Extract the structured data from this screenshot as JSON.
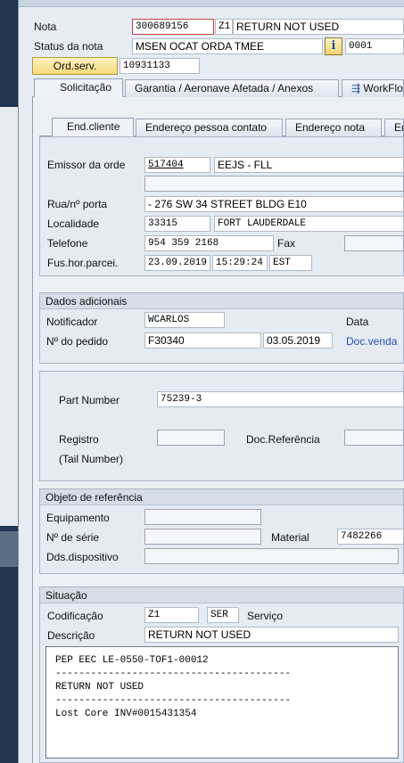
{
  "header": {
    "nota_label": "Nota",
    "nota_number": "300689156",
    "nota_type": "Z1",
    "nota_text": "RETURN NOT USED",
    "status_label": "Status da nota",
    "status_value": "MSEN OCAT ORDA TMEE",
    "status_code": "0001",
    "ordserv_label": "Ord.serv.",
    "ordserv_value": "10931133"
  },
  "main_tabs": {
    "solicitacao": "Solicitação",
    "garantia": "Garantia  / Aeronave Afetada / Anexos",
    "workflow": "WorkFlo"
  },
  "sub_tabs": {
    "end_cliente": "End.cliente",
    "endereco_pessoa": "Endereço pessoa contato",
    "endereco_nota": "Endereço nota",
    "en": "En"
  },
  "cliente": {
    "emissor_label": "Emissor da orde",
    "emissor_code": "517404",
    "emissor_name": "EEJS - FLL",
    "rua_label": "Rua/nº porta",
    "rua_value": "- 276 SW 34 STREET BLDG E10",
    "localidade_label": "Localidade",
    "cep": "33315",
    "cidade": "FORT LAUDERDALE",
    "telefone_label": "Telefone",
    "telefone": "954 359 2168",
    "fax_label": "Fax",
    "fushor_label": "Fus.hor.parcei.",
    "data": "23.09.2019",
    "hora": "15:29:24",
    "fuso": "EST"
  },
  "dados": {
    "title": "Dados adicionais",
    "notificador_label": "Notificador",
    "notificador": "WCARLOS",
    "data_label": "Data",
    "pedido_label": "Nº do pedido",
    "pedido": "F30340",
    "pedido_data": "03.05.2019",
    "docvenda": "Doc.venda"
  },
  "part": {
    "part_label": "Part Number",
    "part_value": "75239-3",
    "registro_label": "Registro",
    "tail_label": "(Tail Number)",
    "docref_label": "Doc.Referência"
  },
  "objeto": {
    "title": "Objeto de referência",
    "equip_label": "Equipamento",
    "serie_label": "Nº de série",
    "material_label": "Material",
    "material": "7482266",
    "dds_label": "Dds.dispositivo"
  },
  "situacao": {
    "title": "Situação",
    "codif_label": "Codificação",
    "codif_grupo": "Z1",
    "codif_code": "SER",
    "codif_text": "Serviço",
    "descr_label": "Descrição",
    "descr_value": "RETURN NOT USED",
    "long_text": "PEP EEC LE-0550-TOF1-00012\n----------------------------------------\nRETURN NOT USED\n----------------------------------------\nLost Core INV#0015431354"
  },
  "icons": {
    "info": "info-icon",
    "workflow": "workflow-icon"
  }
}
